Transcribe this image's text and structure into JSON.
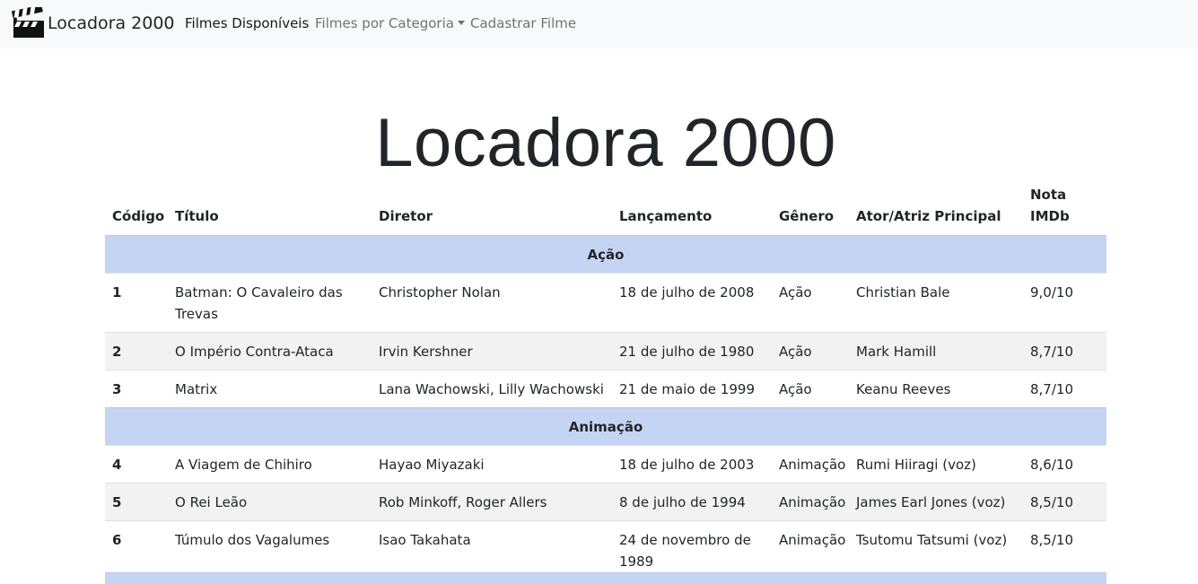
{
  "navbar": {
    "brand": "Locadora 2000",
    "brand_icon": "clapperboard-icon",
    "links": [
      {
        "label": "Filmes Disponíveis",
        "active": true
      },
      {
        "label": "Filmes por Categoria",
        "dropdown": true
      },
      {
        "label": "Cadastrar Filme"
      }
    ]
  },
  "page": {
    "title": "Locadora 2000"
  },
  "table": {
    "headers": [
      "Código",
      "Título",
      "Diretor",
      "Lançamento",
      "Gênero",
      "Ator/Atriz Principal",
      "Nota IMDb"
    ],
    "categories": [
      {
        "name": "Ação",
        "rows": [
          [
            "1",
            "Batman: O Cavaleiro das Trevas",
            "Christopher Nolan",
            "18 de julho de 2008",
            "Ação",
            "Christian Bale",
            "9,0/10"
          ],
          [
            "2",
            "O Império Contra-Ataca",
            "Irvin Kershner",
            "21 de julho de 1980",
            "Ação",
            "Mark Hamill",
            "8,7/10"
          ],
          [
            "3",
            "Matrix",
            "Lana Wachowski, Lilly Wachowski",
            "21 de maio de 1999",
            "Ação",
            "Keanu Reeves",
            "8,7/10"
          ]
        ]
      },
      {
        "name": "Animação",
        "rows": [
          [
            "4",
            "A Viagem de Chihiro",
            "Hayao Miyazaki",
            "18 de julho de 2003",
            "Animação",
            "Rumi Hiiragi (voz)",
            "8,6/10"
          ],
          [
            "5",
            "O Rei Leão",
            "Rob Minkoff, Roger Allers",
            "8 de julho de 1994",
            "Animação",
            "James Earl Jones (voz)",
            "8,5/10"
          ],
          [
            "6",
            "Túmulo dos Vagalumes",
            "Isao Takahata",
            "24 de novembro de 1989",
            "Animação",
            "Tsutomu Tatsumi (voz)",
            "8,5/10"
          ]
        ]
      }
    ]
  },
  "colors": {
    "navbar_bg": "#f8f9fa",
    "category_row_bg": "#c5d4f2",
    "striped_row_bg": "#f2f2f2"
  }
}
